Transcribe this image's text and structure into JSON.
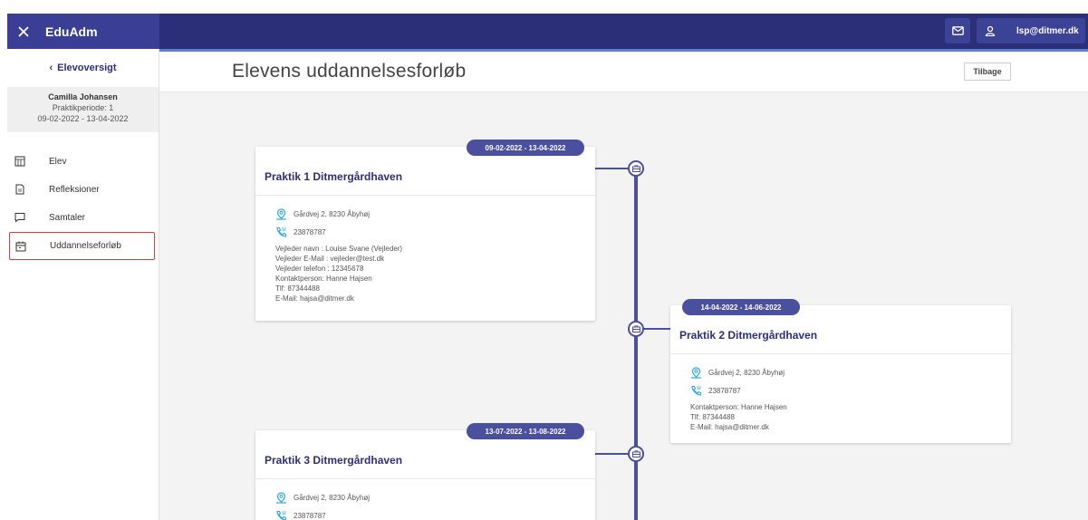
{
  "app": {
    "brand": "EduAdm",
    "user_email": "lsp@ditmer.dk"
  },
  "sidebar": {
    "back_label": "Elevoversigt",
    "student": {
      "name": "Camilla Johansen",
      "period": "Praktikperiode: 1",
      "dates": "09-02-2022 - 13-04-2022"
    },
    "items": [
      {
        "label": "Elev",
        "icon": "calendar-grid-icon"
      },
      {
        "label": "Refleksioner",
        "icon": "document-icon"
      },
      {
        "label": "Samtaler",
        "icon": "chat-icon"
      },
      {
        "label": "Uddannelseforløb",
        "icon": "calendar-icon",
        "active": true
      }
    ]
  },
  "main": {
    "title": "Elevens uddannelsesforløb",
    "back_button": "Tilbage"
  },
  "cards": [
    {
      "dates": "09-02-2022 - 13-04-2022",
      "title": "Praktik 1 Ditmergårdhaven",
      "address": "Gårdvej 2, 8230 Åbyhøj",
      "phone": "23878787",
      "details": [
        "Vejleder navn : Louise Svane (Vejleder)",
        "Vejleder E-Mail : vejleder@test.dk",
        "Vejleder telefon : 12345678",
        "Kontaktperson: Hanne Hajsen",
        "Tlf: 87344488",
        "E-Mail: hajsa@ditmer.dk"
      ]
    },
    {
      "dates": "14-04-2022 - 14-06-2022",
      "title": "Praktik 2 Ditmergårdhaven",
      "address": "Gårdvej 2, 8230 Åbyhøj",
      "phone": "23878787",
      "details": [
        "Kontaktperson: Hanne Hajsen",
        "Tlf: 87344488",
        "E-Mail: hajsa@ditmer.dk"
      ]
    },
    {
      "dates": "13-07-2022 - 13-08-2022",
      "title": "Praktik 3 Ditmergårdhaven",
      "address": "Gårdvej 2, 8230 Åbyhøj",
      "phone": "23878787",
      "details": []
    }
  ]
}
